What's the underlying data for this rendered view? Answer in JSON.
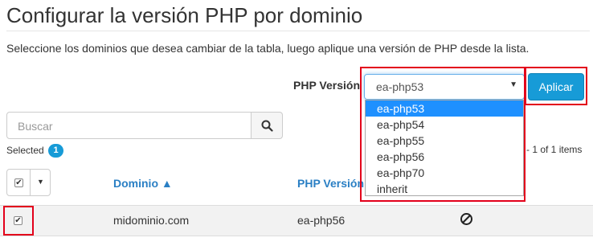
{
  "page": {
    "title": "Configurar la versión PHP por dominio",
    "description": "Seleccione los dominios que desea cambiar de la tabla, luego aplique una versión de PHP desde la lista."
  },
  "php_selector": {
    "label": "PHP Versión",
    "selected_value": "ea-php53",
    "options": [
      "ea-php53",
      "ea-php54",
      "ea-php55",
      "ea-php56",
      "ea-php70",
      "inherit"
    ],
    "apply_label": "Aplicar"
  },
  "search": {
    "placeholder": "Buscar"
  },
  "selection": {
    "label": "Selected",
    "count": "1"
  },
  "pagination": {
    "text": "- 1 of 1 items"
  },
  "table": {
    "columns": [
      {
        "label": "Dominio ▲"
      },
      {
        "label": "PHP Versión"
      }
    ],
    "rows": [
      {
        "checked": true,
        "domain": "midominio.com",
        "php_version": "ea-php56",
        "status_icon": "ban-icon"
      }
    ]
  },
  "colors": {
    "accent": "#179bd7",
    "link": "#2a7fc4",
    "highlight": "#e3001b",
    "dropdown_selected": "#1e90ff"
  }
}
